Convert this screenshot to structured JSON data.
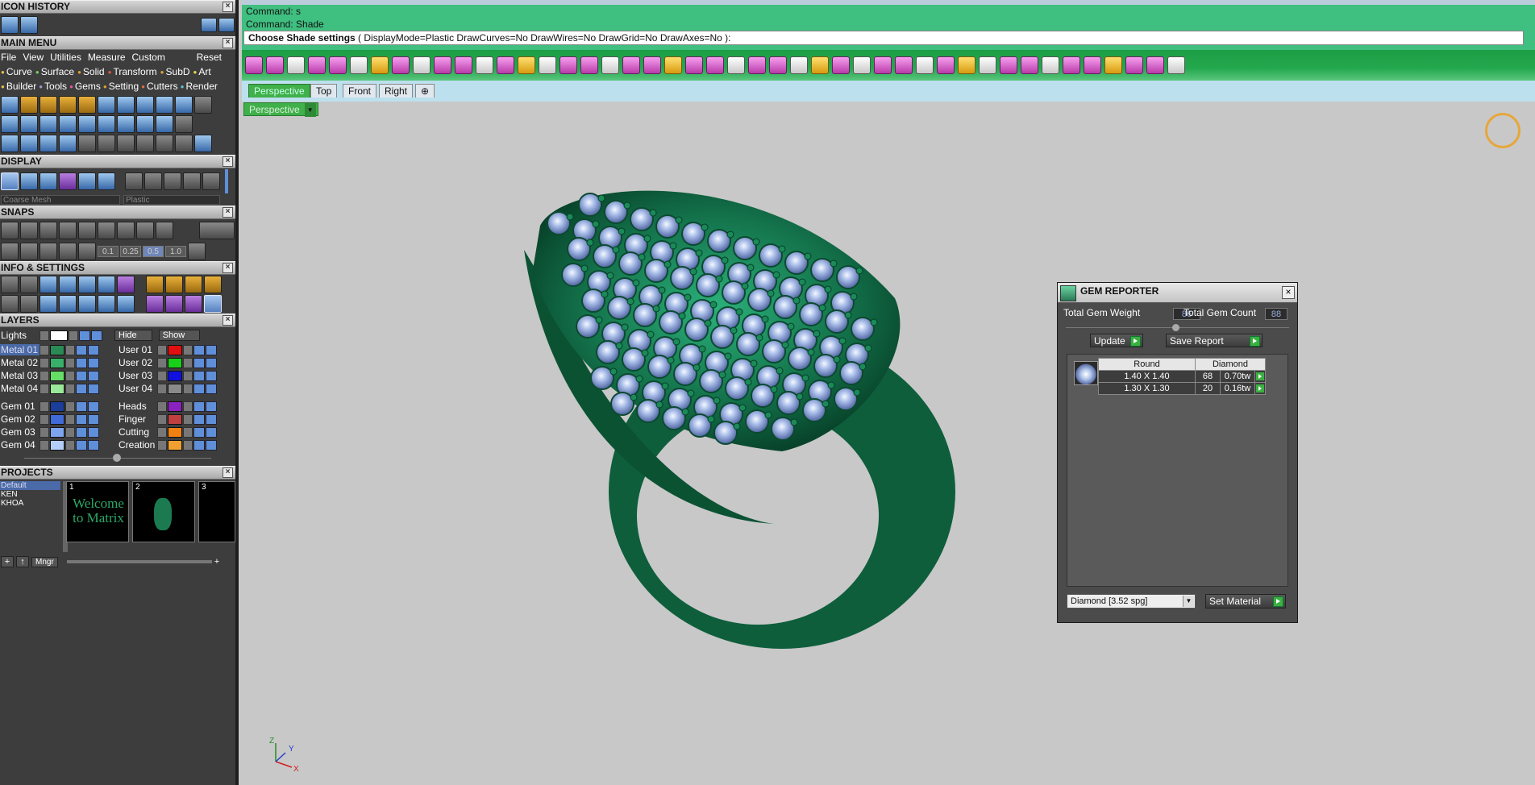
{
  "left_panel": {
    "icon_history": {
      "title": "ICON HISTORY"
    },
    "main_menu": {
      "title": "MAIN MENU",
      "menu_items": [
        "File",
        "View",
        "Utilities",
        "Measure",
        "Custom"
      ],
      "reset": "Reset",
      "row2": [
        "Curve",
        "Surface",
        "Solid",
        "Transform",
        "SubD",
        "Art"
      ],
      "row3": [
        "Builder",
        "Tools",
        "Gems",
        "Setting",
        "Cutters",
        "Render"
      ]
    },
    "display": {
      "title": "DISPLAY",
      "mesh_dropdown": "Coarse Mesh",
      "material_dropdown": "Plastic"
    },
    "snaps": {
      "title": "SNAPS",
      "values": [
        "0.1",
        "0.25",
        "0.5",
        "1.0"
      ]
    },
    "info_settings": {
      "title": "INFO & SETTINGS"
    },
    "layers": {
      "title": "LAYERS",
      "lights": "Lights",
      "hide": "Hide",
      "show": "Show",
      "left_layers": [
        {
          "name": "Metal 01",
          "color": "#2a8a55"
        },
        {
          "name": "Metal 02",
          "color": "#39b06a"
        },
        {
          "name": "Metal 03",
          "color": "#66dd66"
        },
        {
          "name": "Metal 04",
          "color": "#9ae89a"
        },
        {
          "name": "Gem 01",
          "color": "#1c3e98"
        },
        {
          "name": "Gem 02",
          "color": "#3f6ad8"
        },
        {
          "name": "Gem 03",
          "color": "#7ea4f0"
        },
        {
          "name": "Gem 04",
          "color": "#b4cef8"
        }
      ],
      "right_layers": [
        {
          "name": "User 01",
          "color": "#e01010"
        },
        {
          "name": "User 02",
          "color": "#18d018"
        },
        {
          "name": "User 03",
          "color": "#1010e0"
        },
        {
          "name": "User 04",
          "color": "#8a8a8a"
        },
        {
          "name": "Heads",
          "color": "#8a22c0"
        },
        {
          "name": "Finger",
          "color": "#c04040"
        },
        {
          "name": "Cutting",
          "color": "#f08010"
        },
        {
          "name": "Creation",
          "color": "#f0a030"
        }
      ]
    },
    "projects": {
      "title": "PROJECTS",
      "list": [
        "Default",
        "KEN",
        "KHOA"
      ],
      "thumbs": [
        {
          "num": "1",
          "text": "Welcome to Matrix"
        },
        {
          "num": "2",
          "text": ""
        },
        {
          "num": "3",
          "text": ""
        }
      ],
      "mngr": "Mngr"
    }
  },
  "command": {
    "line1": "Command: s",
    "line2": "Command: Shade",
    "prompt_bold": "Choose Shade settings",
    "prompt_rest": "( DisplayMode=Plastic  DrawCurves=No  DrawWires=No  DrawGrid=No  DrawAxes=No ):"
  },
  "viewport_tabs": [
    "Perspective",
    "Top",
    "Front",
    "Right"
  ],
  "viewport_dropdown": "Perspective",
  "gem_reporter": {
    "title": "GEM REPORTER",
    "total_weight_label": "Total Gem Weight",
    "total_weight": "86",
    "total_count_label": "Total Gem Count",
    "total_count": "88",
    "update": "Update",
    "save_report": "Save Report",
    "table_headers": [
      "Round",
      "Diamond"
    ],
    "rows": [
      {
        "size": "1.40 X 1.40",
        "count": "68",
        "weight": "0.70tw"
      },
      {
        "size": "1.30 X 1.30",
        "count": "20",
        "weight": "0.16tw"
      }
    ],
    "material": "Diamond    [3.52 spg]",
    "set_material": "Set Material"
  },
  "axes": {
    "y": "Y",
    "z": "Z",
    "x": "X"
  }
}
